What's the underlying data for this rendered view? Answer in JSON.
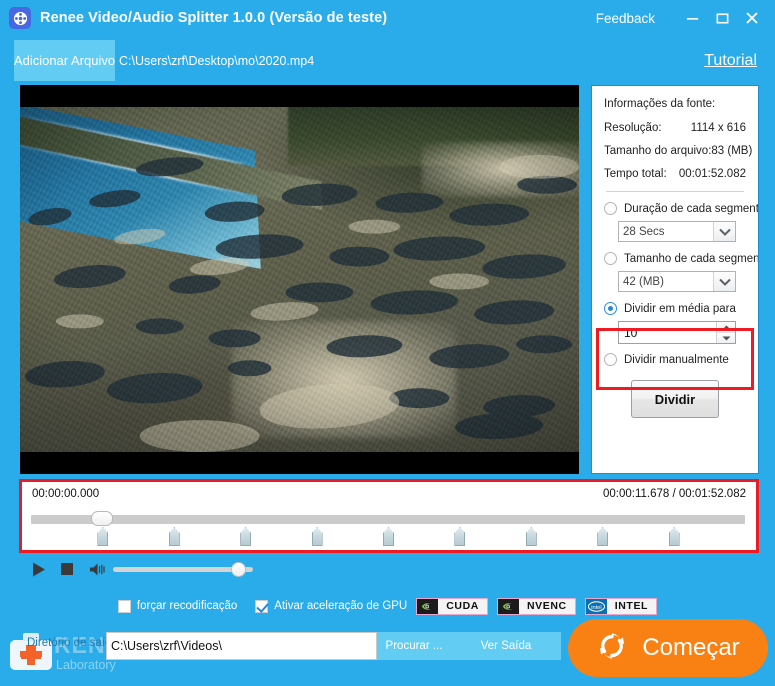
{
  "window": {
    "title": "Renee Video/Audio Splitter 1.0.0 (Versão de teste)",
    "app_icon": "film-reel-icon",
    "feedback_label": "Feedback",
    "minimize_icon": "minimize-icon",
    "maximize_icon": "maximize-icon",
    "close_icon": "close-icon",
    "accent_color": "#29ACE9"
  },
  "toolbar": {
    "add_file_label": "Adicionar Arquivo",
    "file_path": "C:\\Users\\zrf\\Desktop\\mo\\2020.mp4",
    "tutorial_label": "Tutorial"
  },
  "preview": {
    "name": "video-preview",
    "description": "aerial view of coastal wetland with ponds and ocean"
  },
  "info_panel": {
    "heading": "Informações da fonte:",
    "resolution_label": "Resolução:",
    "resolution_value": "1114 x 616",
    "filesize_label": "Tamanho do arquivo:",
    "filesize_value": "83 (MB)",
    "duration_label": "Tempo total:",
    "duration_value": "00:01:52.082",
    "modes": [
      {
        "id": "duration-per-segment",
        "label": "Duração de cada segmento",
        "selected": false,
        "control": "combo",
        "value": "28 Secs"
      },
      {
        "id": "size-per-segment",
        "label": "Tamanho de cada segmento",
        "selected": false,
        "control": "combo",
        "value": "42 (MB)"
      },
      {
        "id": "split-average",
        "label": "Dividir em média para",
        "selected": true,
        "control": "spinner",
        "value": "10"
      },
      {
        "id": "split-manual",
        "label": "Dividir manualmente",
        "selected": false,
        "control": "none",
        "value": ""
      }
    ],
    "split_button_label": "Dividir",
    "highlight_color": "#ED1C24"
  },
  "timeline": {
    "start_time": "00:00:00.000",
    "current_time": "00:00:11.678 / 00:01:52.082",
    "seek_percent": 10,
    "split_marker_count": 9,
    "highlight_color": "#ED1C24"
  },
  "transport": {
    "play_icon": "play-icon",
    "stop_icon": "stop-icon",
    "volume_icon": "volume-icon",
    "volume_percent": 89
  },
  "options": {
    "force_reencode": {
      "label": "forçar recodificação",
      "checked": false
    },
    "gpu_acceleration": {
      "label": "Ativar aceleração de GPU",
      "checked": true
    },
    "gpu_badges": [
      {
        "name": "cuda",
        "label": "CUDA",
        "logo": "nvidia-logo"
      },
      {
        "name": "nvenc",
        "label": "NVENC",
        "logo": "nvidia-logo"
      },
      {
        "name": "intel",
        "label": "INTEL",
        "logo": "intel-logo"
      }
    ]
  },
  "output": {
    "dir_label": "Diretório de saída:",
    "dir_value": "C:\\Users\\zrf\\Videos\\",
    "browse_label": "Procurar ...",
    "view_output_label": "Ver Saída",
    "start_label": "Começar",
    "start_icon": "refresh-icon",
    "start_color": "#F98012"
  },
  "watermark": {
    "brand": "RENE.E",
    "sub": "Laboratory",
    "icon": "first-aid-kit-icon"
  }
}
